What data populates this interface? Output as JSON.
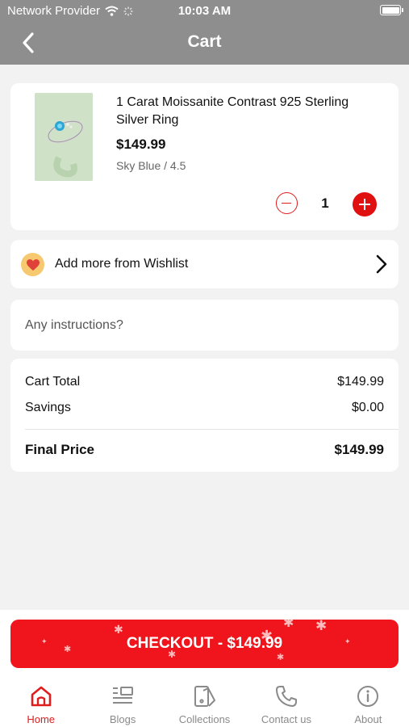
{
  "status_bar": {
    "carrier": "Network Provider",
    "time": "10:03 AM"
  },
  "nav": {
    "title": "Cart",
    "back_icon": "chevron-left-icon"
  },
  "cart_item": {
    "name": "1 Carat Moissanite Contrast 925 Sterling Silver Ring",
    "price": "$149.99",
    "variant": "Sky Blue / 4.5",
    "quantity": "1"
  },
  "wishlist": {
    "label": "Add more from Wishlist",
    "icon": "heart-icon"
  },
  "instructions": {
    "placeholder": "Any instructions?",
    "value": ""
  },
  "summary": {
    "cart_total_label": "Cart Total",
    "cart_total_value": "$149.99",
    "savings_label": "Savings",
    "savings_value": "$0.00",
    "final_label": "Final Price",
    "final_value": "$149.99"
  },
  "checkout": {
    "label": "CHECKOUT - $149.99"
  },
  "tabs": [
    {
      "label": "Home",
      "icon": "home-icon",
      "active": true
    },
    {
      "label": "Blogs",
      "icon": "blogs-icon",
      "active": false
    },
    {
      "label": "Collections",
      "icon": "collections-icon",
      "active": false
    },
    {
      "label": "Contact us",
      "icon": "phone-icon",
      "active": false
    },
    {
      "label": "About",
      "icon": "info-icon",
      "active": false
    }
  ],
  "colors": {
    "accent": "#e01d1d",
    "header": "#8e8e8e",
    "background": "#f2f2f2"
  }
}
